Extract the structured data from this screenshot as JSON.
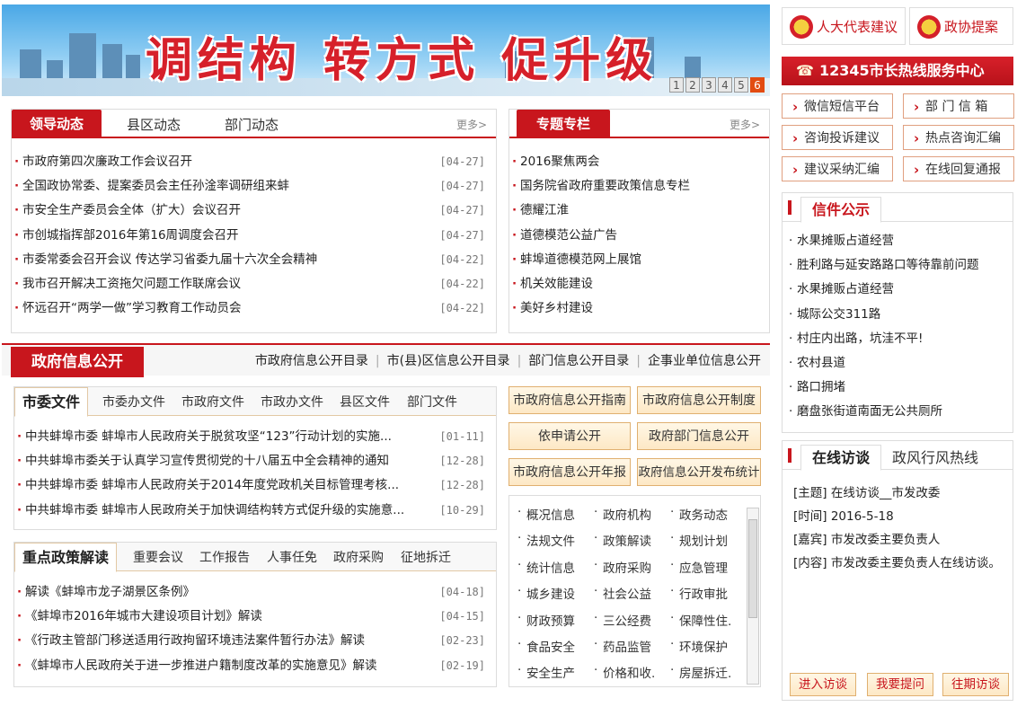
{
  "banner": {
    "title": "调结构 转方式 促升级",
    "pages": [
      "1",
      "2",
      "3",
      "4",
      "5",
      "6"
    ],
    "active_page": "6"
  },
  "leader": {
    "tabs": [
      "领导动态",
      "县区动态",
      "部门动态"
    ],
    "more": "更多>",
    "items": [
      {
        "title": "市政府第四次廉政工作会议召开",
        "date": "[04-27]"
      },
      {
        "title": "全国政协常委、提案委员会主任孙淦率调研组来蚌",
        "date": "[04-27]"
      },
      {
        "title": "市安全生产委员会全体（扩大）会议召开",
        "date": "[04-27]"
      },
      {
        "title": "市创城指挥部2016年第16周调度会召开",
        "date": "[04-27]"
      },
      {
        "title": "市委常委会召开会议 传达学习省委九届十六次全会精神",
        "date": "[04-22]"
      },
      {
        "title": "我市召开解决工资拖欠问题工作联席会议",
        "date": "[04-22]"
      },
      {
        "title": "怀远召开“两学一做”学习教育工作动员会",
        "date": "[04-22]"
      }
    ]
  },
  "special": {
    "tab": "专题专栏",
    "more": "更多>",
    "items": [
      "2016聚焦两会",
      "国务院省政府重要政策信息专栏",
      "德耀江淮",
      "道德模范公益广告",
      "蚌埠道德模范网上展馆",
      "机关效能建设",
      "美好乡村建设"
    ]
  },
  "right": {
    "npc": "人大代表建议",
    "cppcc": "政协提案",
    "hotline": "12345市长热线服务中心",
    "services": [
      "微信短信平台",
      "部 门 信 箱",
      "咨询投诉建议",
      "热点咨询汇编",
      "建议采纳汇编",
      "在线回复通报"
    ],
    "letters": {
      "title": "信件公示",
      "items": [
        "水果摊贩占道经营",
        "胜利路与延安路路口等待靠前问题",
        "水果摊贩占道经营",
        "城际公交311路",
        "村庄内出路，坑洼不平!",
        "农村县道",
        "路口拥堵",
        "磨盘张街道南面无公共厕所"
      ]
    },
    "interview": {
      "tabs": [
        "在线访谈",
        "政风行风热线"
      ],
      "lines": [
        "[主题] 在线访谈__市发改委",
        "[时间] 2016-5-18",
        "[嘉宾] 市发改委主要负责人",
        "[内容] 市发改委主要负责人在线访谈。"
      ],
      "buttons": [
        "进入访谈",
        "我要提问",
        "往期访谈"
      ]
    }
  },
  "gov": {
    "title": "政府信息公开",
    "links": [
      "市政府信息公开目录",
      "市(县)区信息公开目录",
      "部门信息公开目录",
      "企事业单位信息公开"
    ],
    "docs": {
      "tabs": [
        "市委文件",
        "市委办文件",
        "市政府文件",
        "市政办文件",
        "县区文件",
        "部门文件"
      ],
      "items": [
        {
          "title": "中共蚌埠市委 蚌埠市人民政府关于脱贫攻坚“123”行动计划的实施...",
          "date": "[01-11]"
        },
        {
          "title": "中共蚌埠市委关于认真学习宣传贯彻党的十八届五中全会精神的通知",
          "date": "[12-28]"
        },
        {
          "title": "中共蚌埠市委 蚌埠市人民政府关于2014年度党政机关目标管理考核...",
          "date": "[12-28]"
        },
        {
          "title": "中共蚌埠市委 蚌埠市人民政府关于加快调结构转方式促升级的实施意...",
          "date": "[10-29]"
        }
      ]
    },
    "policy": {
      "tabs": [
        "重点政策解读",
        "重要会议",
        "工作报告",
        "人事任免",
        "政府采购",
        "征地拆迁"
      ],
      "items": [
        {
          "title": "解读《蚌埠市龙子湖景区条例》",
          "date": "[04-18]"
        },
        {
          "title": "《蚌埠市2016年城市大建设项目计划》解读",
          "date": "[04-15]"
        },
        {
          "title": "《行政主管部门移送适用行政拘留环境违法案件暂行办法》解读",
          "date": "[02-23]"
        },
        {
          "title": "《蚌埠市人民政府关于进一步推进户籍制度改革的实施意见》解读",
          "date": "[02-19]"
        }
      ]
    },
    "buttons": [
      "市政府信息公开指南",
      "市政府信息公开制度",
      "依申请公开",
      "政府部门信息公开",
      "市政府信息公开年报",
      "政府信息公开发布统计"
    ],
    "categories": [
      "概况信息",
      "政府机构",
      "政务动态",
      "法规文件",
      "政策解读",
      "规划计划",
      "统计信息",
      "政府采购",
      "应急管理",
      "城乡建设",
      "社会公益",
      "行政审批",
      "财政预算",
      "三公经费",
      "保障性住.",
      "食品安全",
      "药品监管",
      "环境保护",
      "安全生产",
      "价格和收.",
      "房屋拆迁."
    ]
  }
}
